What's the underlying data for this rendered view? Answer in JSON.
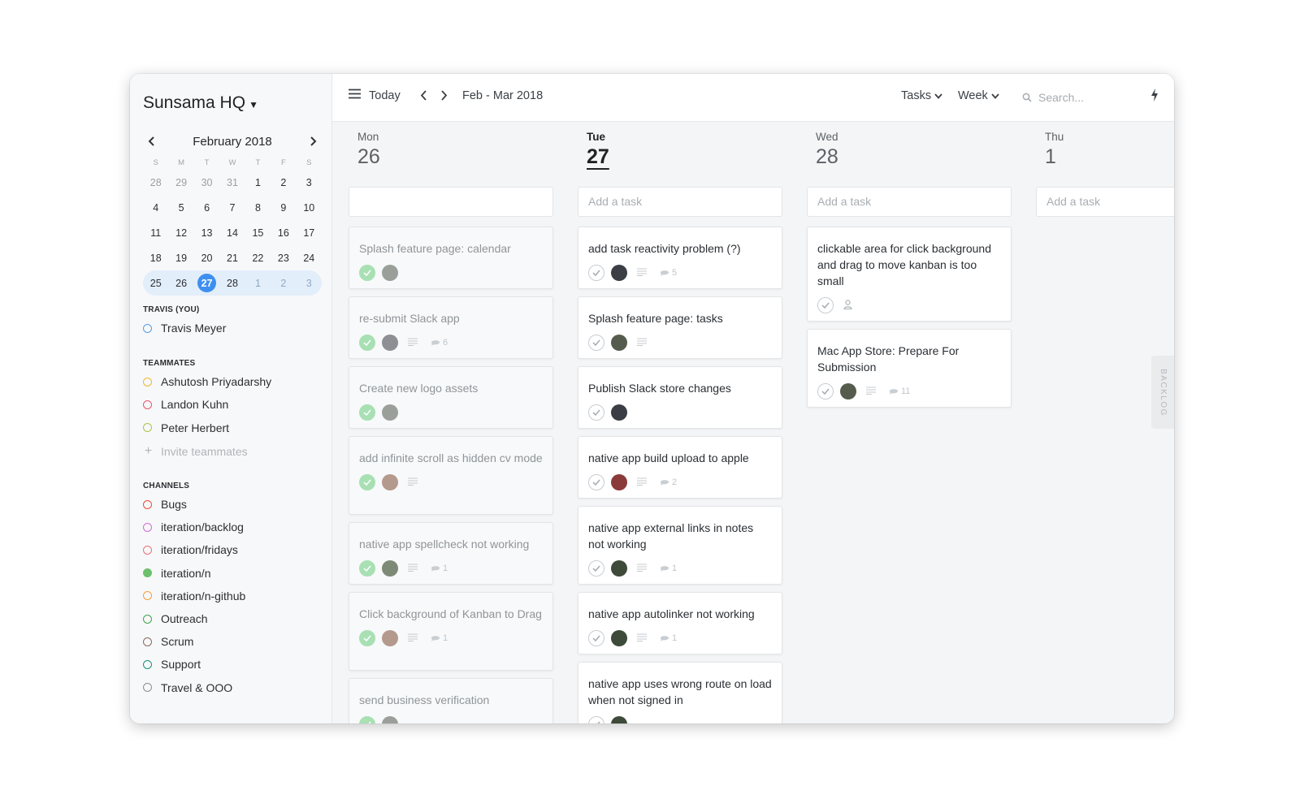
{
  "window": {
    "traffic_lights": [
      "#ee5f57",
      "#f5bf4f",
      "#62c654"
    ]
  },
  "sidebar": {
    "workspace": "Sunsama HQ",
    "calendar": {
      "month": "February 2018",
      "dow": [
        "S",
        "M",
        "T",
        "W",
        "T",
        "F",
        "S"
      ],
      "weeks": [
        [
          "28",
          "29",
          "30",
          "31",
          "1",
          "2",
          "3"
        ],
        [
          "4",
          "5",
          "6",
          "7",
          "8",
          "9",
          "10"
        ],
        [
          "11",
          "12",
          "13",
          "14",
          "15",
          "16",
          "17"
        ],
        [
          "18",
          "19",
          "20",
          "21",
          "22",
          "23",
          "24"
        ],
        [
          "25",
          "26",
          "27",
          "28",
          "1",
          "2",
          "3"
        ]
      ],
      "selected_day": "27"
    },
    "you_title": "TRAVIS (YOU)",
    "you": {
      "name": "Travis Meyer",
      "color": "#5a9be8"
    },
    "teammates_title": "TEAMMATES",
    "teammates": [
      {
        "name": "Ashutosh Priyadarshy",
        "color": "#f0b733"
      },
      {
        "name": "Landon Kuhn",
        "color": "#e8556d"
      },
      {
        "name": "Peter Herbert",
        "color": "#a9c64a"
      }
    ],
    "invite": "Invite teammates",
    "channels_title": "CHANNELS",
    "channels": [
      {
        "name": "Bugs",
        "color": "#e74c3c",
        "filled": false
      },
      {
        "name": "iteration/backlog",
        "color": "#d06ed6",
        "filled": false
      },
      {
        "name": "iteration/fridays",
        "color": "#e8737a",
        "filled": false
      },
      {
        "name": "iteration/n",
        "color": "#6cbf6c",
        "filled": true
      },
      {
        "name": "iteration/n-github",
        "color": "#f2a03d",
        "filled": false
      },
      {
        "name": "Outreach",
        "color": "#3fa34d",
        "filled": false
      },
      {
        "name": "Scrum",
        "color": "#8a6a5c",
        "filled": false
      },
      {
        "name": "Support",
        "color": "#1f8f7a",
        "filled": false
      },
      {
        "name": "Travel & OOO",
        "color": "#8a9095",
        "filled": false
      }
    ]
  },
  "toolbar": {
    "today": "Today",
    "range": "Feb - Mar 2018",
    "tasks": "Tasks",
    "week": "Week",
    "search_placeholder": "Search..."
  },
  "days": [
    {
      "name": "Mon",
      "num": "26",
      "today": false,
      "add": "",
      "tasks": [
        {
          "title": "Splash feature page: calendar",
          "done": true,
          "avatar": "#9a9f9a",
          "notes": false,
          "comments": ""
        },
        {
          "title": "re-submit Slack app",
          "done": true,
          "avatar": "#8d8f94",
          "notes": true,
          "comments": "6"
        },
        {
          "title": "Create new logo assets",
          "done": true,
          "avatar": "#9a9f9a",
          "notes": false,
          "comments": ""
        },
        {
          "title": "add infinite scroll as hidden cv mode",
          "done": true,
          "avatar": "#b49a8c",
          "notes": true,
          "comments": ""
        },
        {
          "title": "native app spellcheck not working",
          "done": true,
          "avatar": "#7e8a78",
          "notes": true,
          "comments": "1"
        },
        {
          "title": "Click background of Kanban to Drag",
          "done": true,
          "avatar": "#b49a8c",
          "notes": true,
          "comments": "1"
        },
        {
          "title": "send business verification",
          "done": true,
          "avatar": "#9a9f9a",
          "notes": false,
          "comments": ""
        }
      ]
    },
    {
      "name": "Tue",
      "num": "27",
      "today": true,
      "add": "Add a task",
      "tasks": [
        {
          "title": "add task reactivity problem (?)",
          "done": false,
          "avatar": "#3b3f45",
          "notes": true,
          "comments": "5"
        },
        {
          "title": "Splash feature page: tasks",
          "done": false,
          "avatar": "#555c4d",
          "notes": true,
          "comments": ""
        },
        {
          "title": "Publish Slack store changes",
          "done": false,
          "avatar": "#3b3f45",
          "notes": false,
          "comments": ""
        },
        {
          "title": "native app build upload to apple",
          "done": false,
          "avatar": "#8b3a3a",
          "notes": true,
          "comments": "2"
        },
        {
          "title": "native app external links in notes not working",
          "done": false,
          "avatar": "#3e4a3a",
          "notes": true,
          "comments": "1"
        },
        {
          "title": "native app autolinker not working",
          "done": false,
          "avatar": "#3e4a3a",
          "notes": true,
          "comments": "1"
        },
        {
          "title": "native app uses wrong route on load when not signed in",
          "done": false,
          "avatar": "#3e4a3a",
          "notes": false,
          "comments": ""
        }
      ]
    },
    {
      "name": "Wed",
      "num": "28",
      "today": false,
      "add": "Add a task",
      "tasks": [
        {
          "title": "clickable area for click background and drag to move kanban is too small",
          "done": false,
          "avatar": "",
          "notes": false,
          "comments": ""
        },
        {
          "title": "Mac App Store: Prepare For Submission",
          "done": false,
          "avatar": "#555c4d",
          "notes": true,
          "comments": "11"
        }
      ]
    },
    {
      "name": "Thu",
      "num": "1",
      "today": false,
      "add": "Add a task",
      "tasks": []
    }
  ],
  "backlog_label": "BACKLOG"
}
